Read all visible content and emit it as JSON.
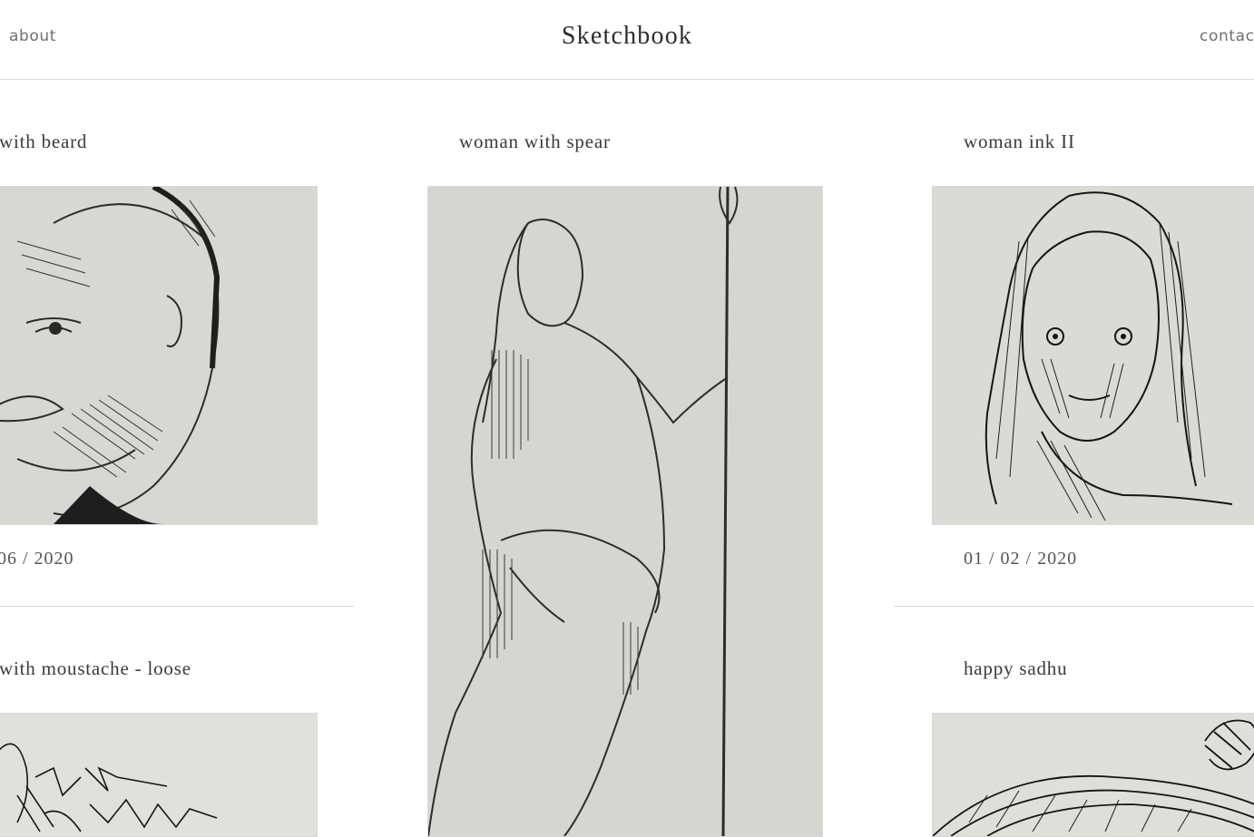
{
  "header": {
    "site_title": "Sketchbook",
    "nav_about": "about",
    "nav_contact": "contact"
  },
  "cards": [
    {
      "title": "with beard",
      "date": "06 / 2020",
      "image": "pencil-portrait-man-with-beard"
    },
    {
      "title": "woman with spear",
      "image": "pencil-sketch-woman-with-spear"
    },
    {
      "title": "woman ink II",
      "date": "01 / 02 / 2020",
      "image": "ink-portrait-woman"
    },
    {
      "title": "with moustache - loose",
      "image": "ink-sketch-man-with-moustache"
    },
    {
      "title": "happy sadhu",
      "image": "ink-sketch-happy-sadhu"
    }
  ],
  "colors": {
    "paper": "#d9d7d1",
    "ink": "#1c1c1c",
    "divider": "#d6d6d6"
  }
}
